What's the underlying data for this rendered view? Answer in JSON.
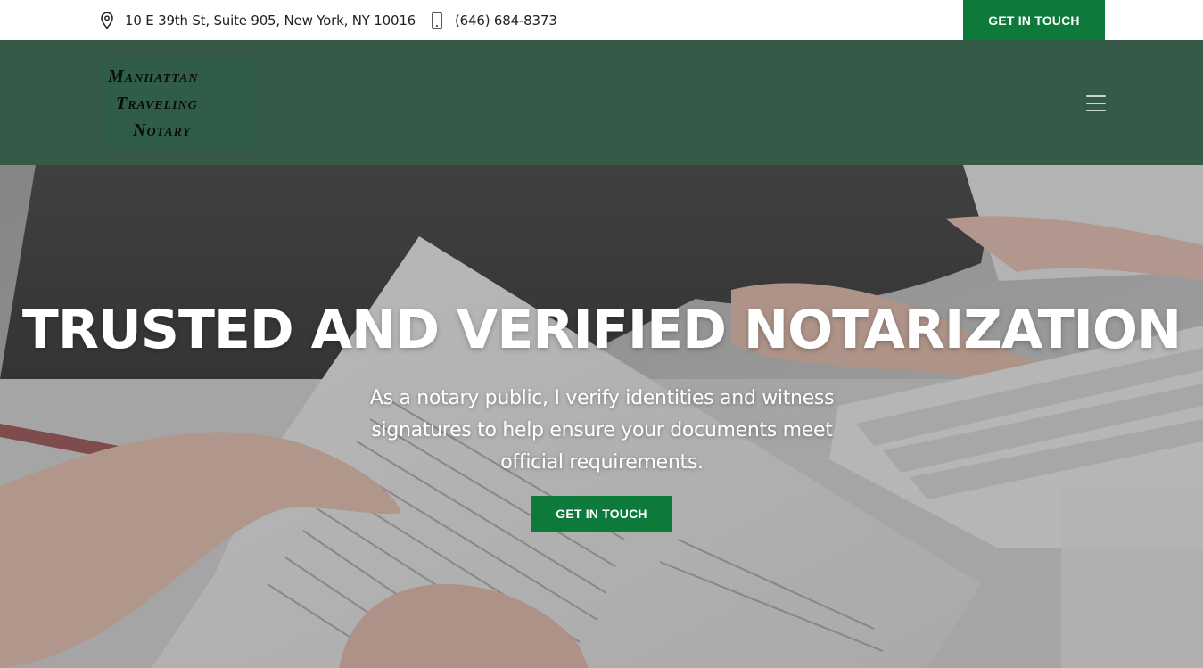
{
  "topbar": {
    "address": "10 E 39th St, Suite 905, New York, NY 10016",
    "phone": "(646) 684-8373",
    "cta_label": "GET IN TOUCH",
    "address_icon": "map-pin-icon",
    "phone_icon": "mobile-phone-icon"
  },
  "header": {
    "logo": {
      "line1": "Manhattan",
      "line2": "Traveling",
      "line3": "Notary"
    },
    "menu_icon": "hamburger-menu-icon"
  },
  "hero": {
    "title": "TRUSTED AND VERIFIED NOTARIZATION",
    "subtitle": "As a notary public, I verify identities and witness signatures to help ensure your documents meet official requirements.",
    "cta_label": "GET IN TOUCH"
  },
  "colors": {
    "accent_green": "#0d7a3c",
    "header_green": "#355a47"
  }
}
